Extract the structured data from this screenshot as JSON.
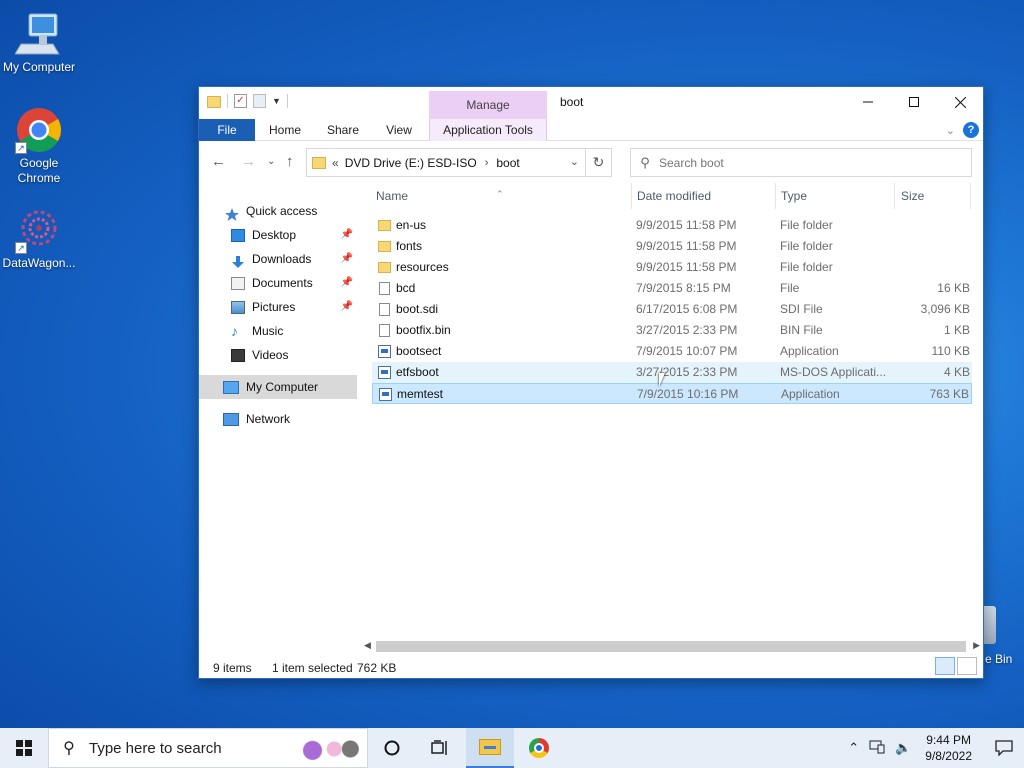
{
  "desktop": {
    "icons": [
      {
        "label": "My Computer",
        "icon": "computer-icon"
      },
      {
        "label": "Google Chrome",
        "icon": "chrome-icon"
      },
      {
        "label": "DataWagon...",
        "icon": "datawagon-icon"
      }
    ],
    "recycle_partial": "e Bin"
  },
  "window": {
    "title": "boot",
    "manage_tab": "Manage",
    "ribbon_tabs": [
      "File",
      "Home",
      "Share",
      "View",
      "Application Tools"
    ],
    "address": {
      "overflow": "«",
      "crumbs": [
        "DVD Drive (E:) ESD-ISO",
        "boot"
      ]
    },
    "search_placeholder": "Search boot",
    "nav": {
      "quick_access": "Quick access",
      "items": [
        "Desktop",
        "Downloads",
        "Documents",
        "Pictures",
        "Music",
        "Videos"
      ],
      "my_computer": "My Computer",
      "network": "Network"
    },
    "columns": [
      "Name",
      "Date modified",
      "Type",
      "Size"
    ],
    "files": [
      {
        "name": "en-us",
        "date": "9/9/2015 11:58 PM",
        "type": "File folder",
        "size": "",
        "kind": "folder"
      },
      {
        "name": "fonts",
        "date": "9/9/2015 11:58 PM",
        "type": "File folder",
        "size": "",
        "kind": "folder"
      },
      {
        "name": "resources",
        "date": "9/9/2015 11:58 PM",
        "type": "File folder",
        "size": "",
        "kind": "folder"
      },
      {
        "name": "bcd",
        "date": "7/9/2015 8:15 PM",
        "type": "File",
        "size": "16 KB",
        "kind": "file"
      },
      {
        "name": "boot.sdi",
        "date": "6/17/2015 6:08 PM",
        "type": "SDI File",
        "size": "3,096 KB",
        "kind": "file"
      },
      {
        "name": "bootfix.bin",
        "date": "3/27/2015 2:33 PM",
        "type": "BIN File",
        "size": "1 KB",
        "kind": "file"
      },
      {
        "name": "bootsect",
        "date": "7/9/2015 10:07 PM",
        "type": "Application",
        "size": "110 KB",
        "kind": "app"
      },
      {
        "name": "etfsboot",
        "date": "3/27/2015 2:33 PM",
        "type": "MS-DOS Applicati...",
        "size": "4 KB",
        "kind": "app"
      },
      {
        "name": "memtest",
        "date": "7/9/2015 10:16 PM",
        "type": "Application",
        "size": "763 KB",
        "kind": "app"
      }
    ],
    "status": {
      "count": "9 items",
      "selected": "1 item selected",
      "size": "762 KB"
    }
  },
  "taskbar": {
    "search_placeholder": "Type here to search",
    "time": "9:44 PM",
    "date": "9/8/2022"
  }
}
